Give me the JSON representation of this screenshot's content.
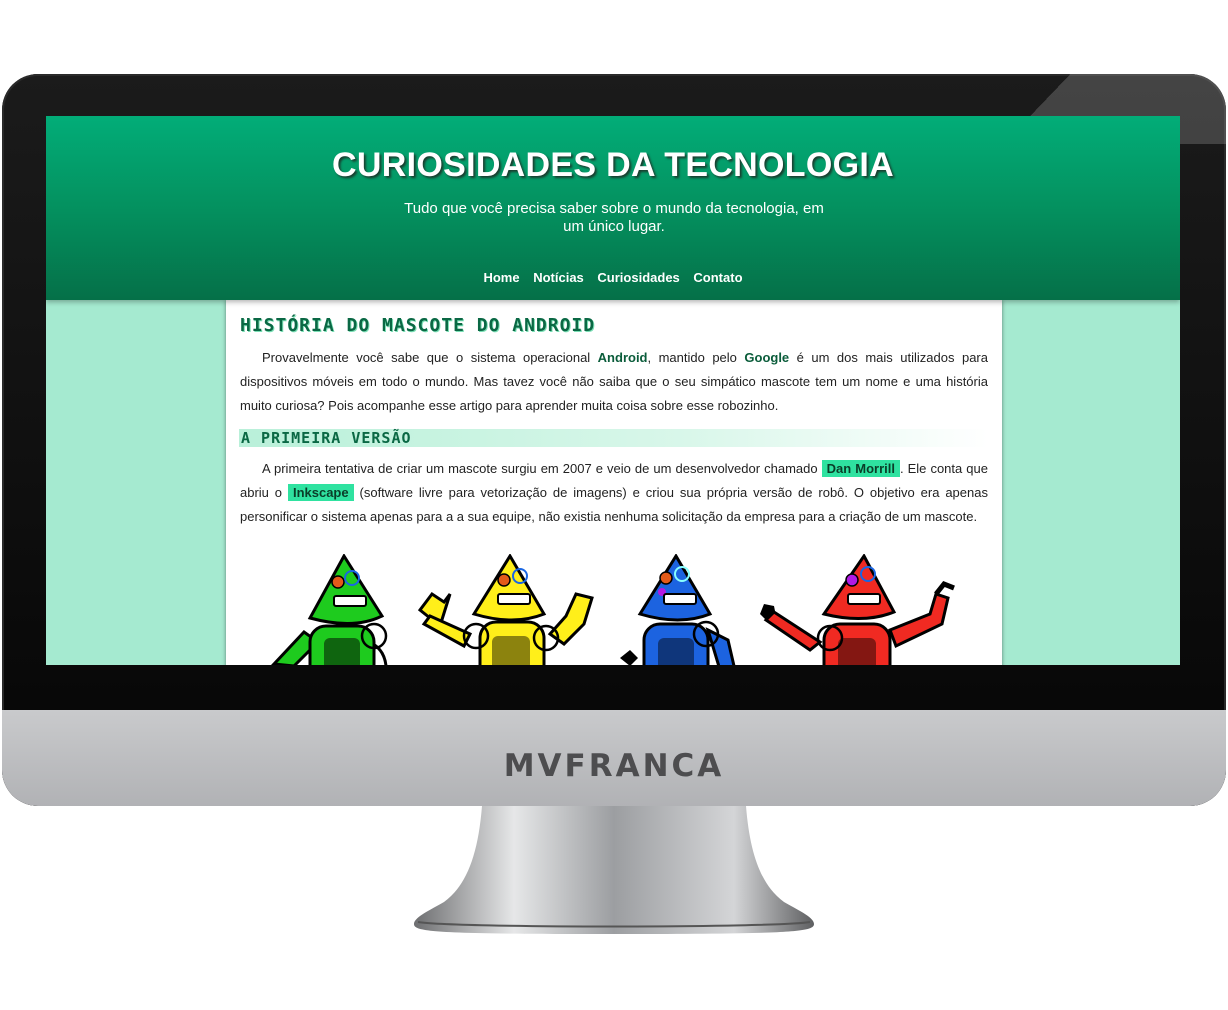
{
  "site": {
    "title": "CURIOSIDADES DA TECNOLOGIA",
    "subtitle": "Tudo que você precisa saber sobre o mundo da tecnologia, em um único lugar.",
    "nav": [
      "Home",
      "Notícias",
      "Curiosidades",
      "Contato"
    ]
  },
  "article": {
    "title": "HISTÓRIA DO MASCOTE DO ANDROID",
    "p1": {
      "t1": "Provavelmente você sabe que o sistema operacional ",
      "android": "Android",
      "t2": ", mantido pelo ",
      "google": "Google",
      "t3": " é um dos mais utilizados para dispositivos móveis em todo o mundo. Mas tavez você não saiba que o seu simpático mascote tem um nome e uma história muito curiosa? Pois acompanhe esse artigo para aprender muita coisa sobre esse robozinho."
    },
    "section_title": "A PRIMEIRA VERSÃO",
    "p2": {
      "t1": "A primeira tentativa de criar um mascote surgiu em 2007 e veio de um desenvolvedor chamado ",
      "dan": "Dan Morrill",
      "t2": ". Ele conta que abriu o ",
      "inkscape": "Inkscape",
      "t3": " (software livre para vetorização de imagens) e criou sua própria versão de robô. O objetivo era apenas personificar o sistema apenas para a a sua equipe, não existia nenhuma solicitação da empresa para a criação de um mascote."
    }
  },
  "robot_colors": [
    "#1ecb1e",
    "#ffef1a",
    "#1c63e0",
    "#f02a22"
  ],
  "colors": {
    "header": "#04915f",
    "background": "#a5ead0",
    "highlight": "#2fe2a0"
  },
  "monitor": {
    "brand": "MVFRANCA"
  }
}
